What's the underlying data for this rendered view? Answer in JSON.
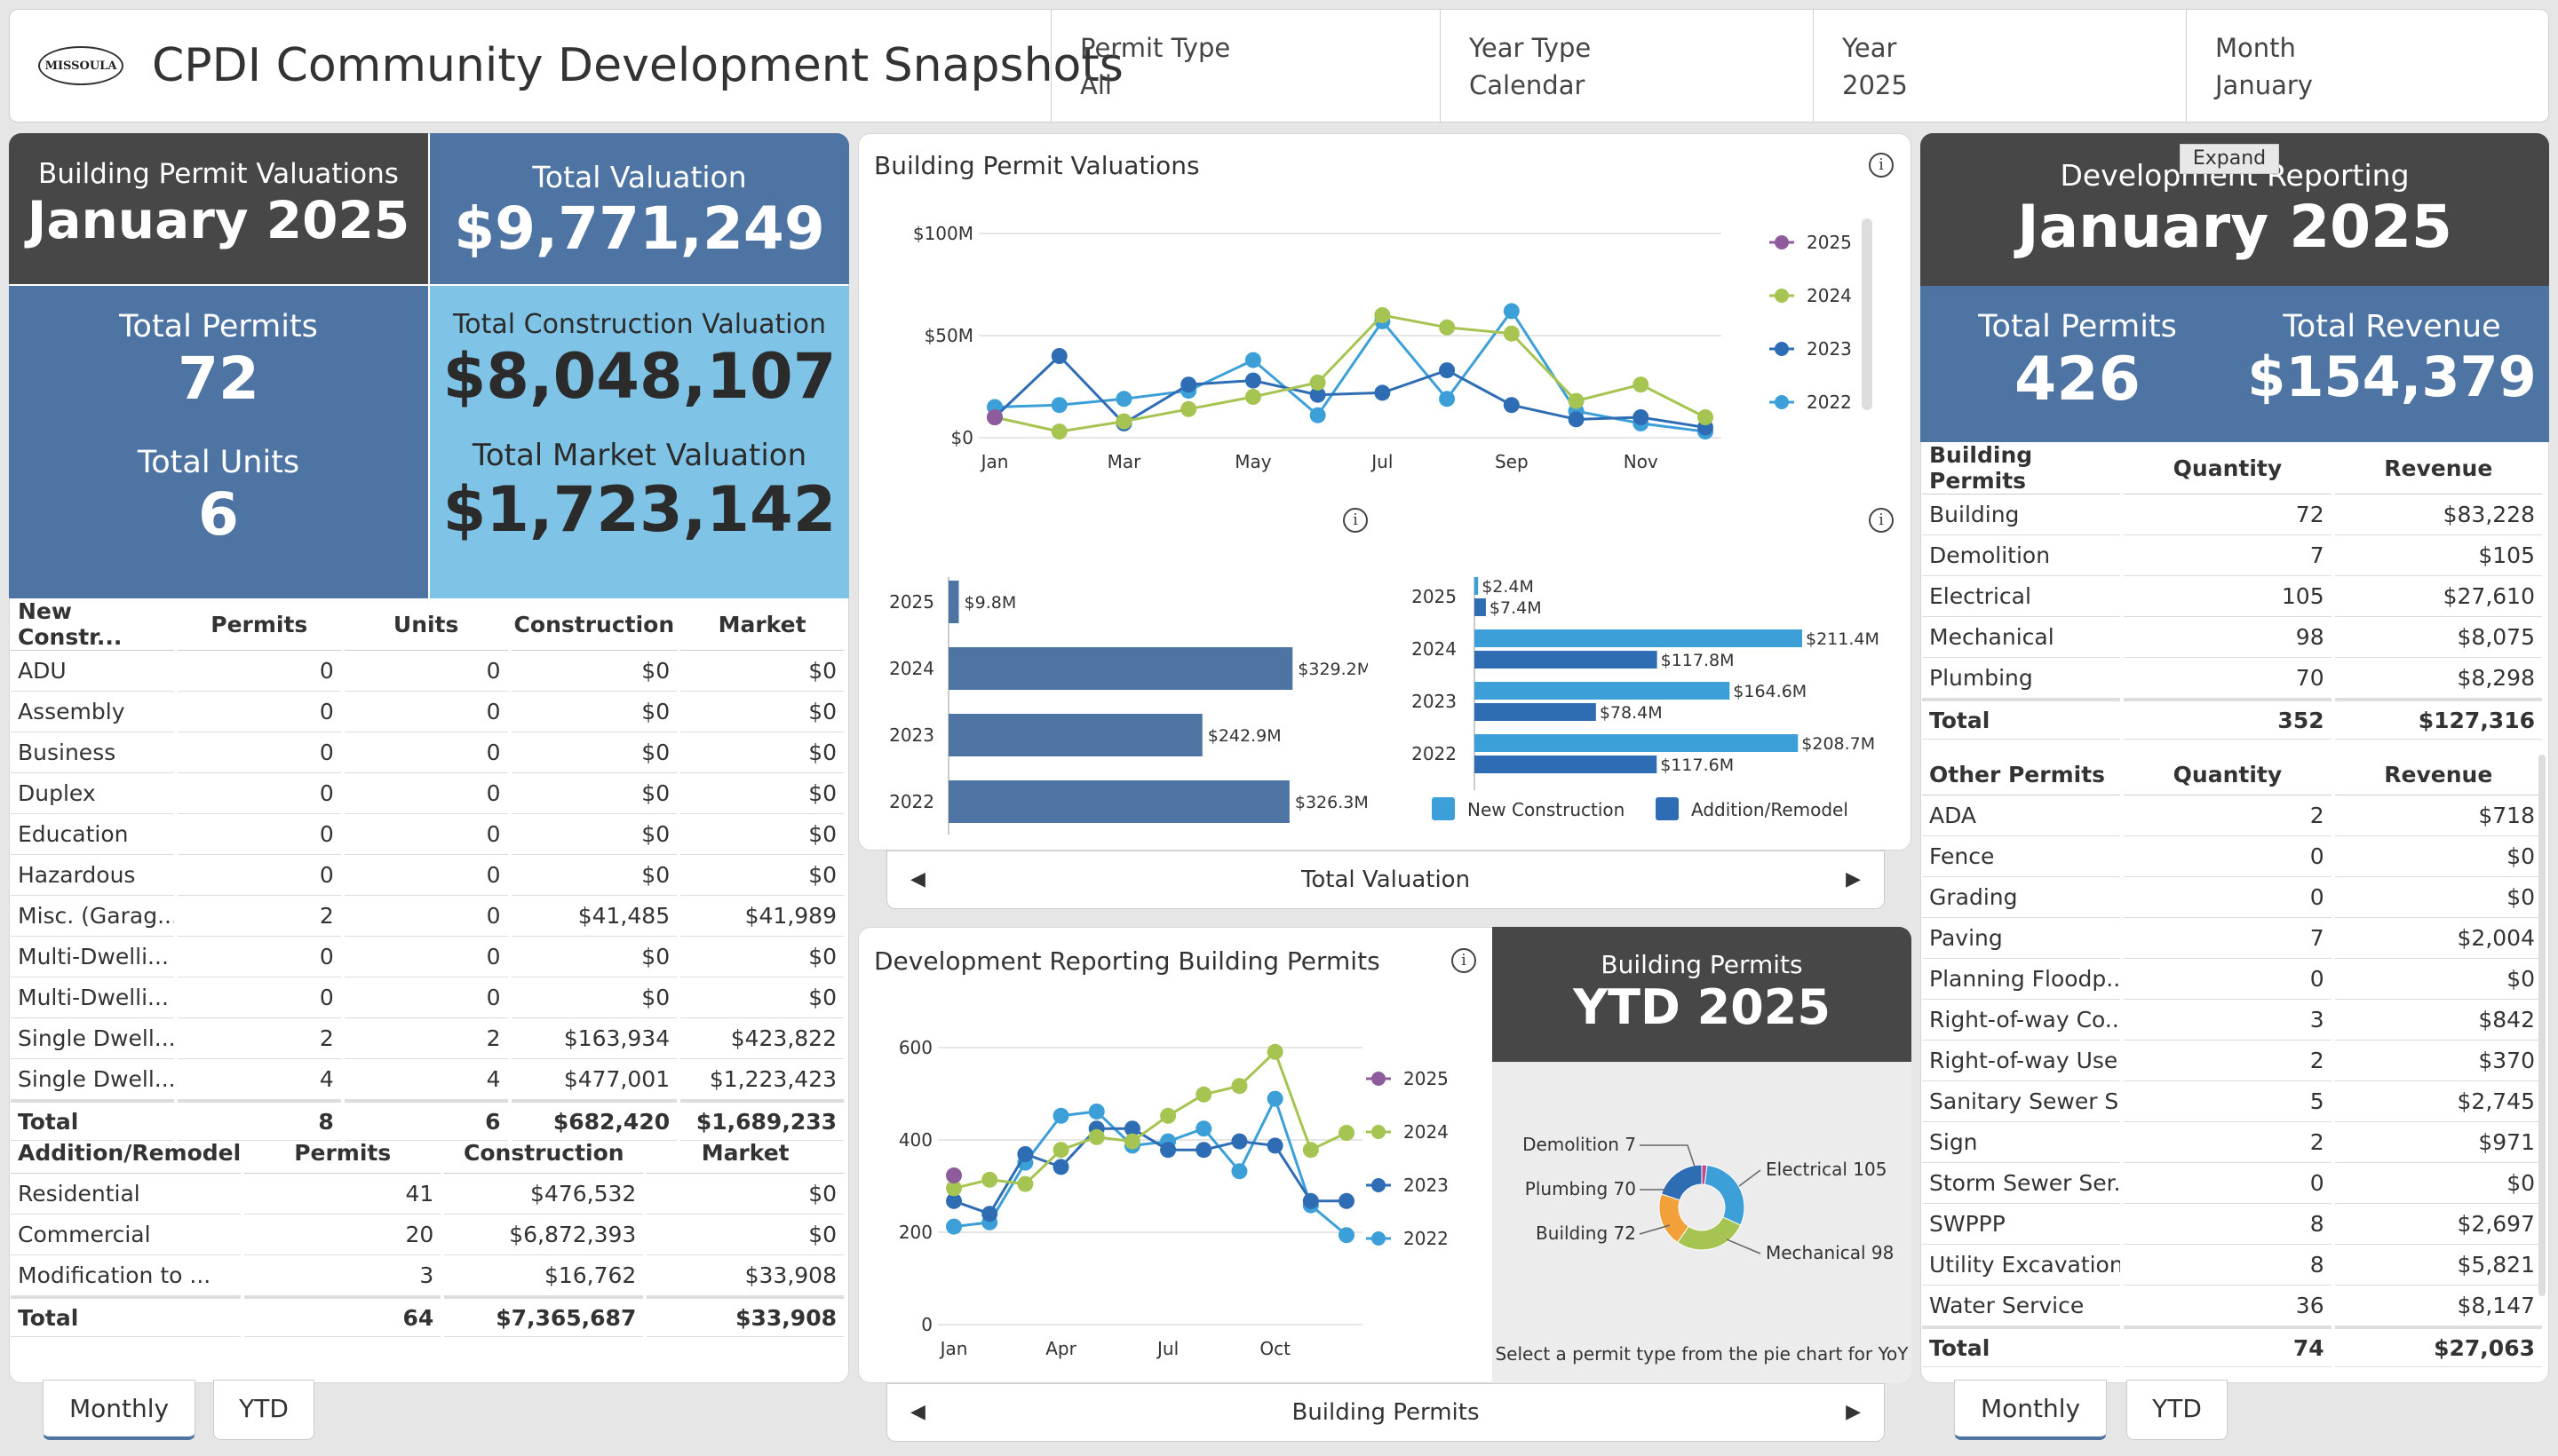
{
  "header": {
    "logo_text": "MISSOULA",
    "title": "CPDI Community Development Snapshots",
    "filters": [
      {
        "label": "Permit Type",
        "value": "All"
      },
      {
        "label": "Year Type",
        "value": "Calendar"
      },
      {
        "label": "Year",
        "value": "2025"
      },
      {
        "label": "Month",
        "value": "January"
      }
    ],
    "expand_label": "Expand"
  },
  "left": {
    "valuations_title": "Building Permit Valuations",
    "period": "January 2025",
    "total_valuation_label": "Total Valuation",
    "total_valuation": "$9,771,249",
    "total_permits_label": "Total Permits",
    "total_permits": "72",
    "total_units_label": "Total Units",
    "total_units": "6",
    "construction_label": "Total Construction Valuation",
    "construction": "$8,048,107",
    "market_label": "Total Market Valuation",
    "market": "$1,723,142",
    "new_construction": {
      "headers": [
        "New Constr...",
        "Permits",
        "Units",
        "Construction",
        "Market"
      ],
      "rows": [
        [
          "ADU",
          "0",
          "0",
          "$0",
          "$0"
        ],
        [
          "Assembly",
          "0",
          "0",
          "$0",
          "$0"
        ],
        [
          "Business",
          "0",
          "0",
          "$0",
          "$0"
        ],
        [
          "Duplex",
          "0",
          "0",
          "$0",
          "$0"
        ],
        [
          "Education",
          "0",
          "0",
          "$0",
          "$0"
        ],
        [
          "Hazardous",
          "0",
          "0",
          "$0",
          "$0"
        ],
        [
          "Misc. (Garag...",
          "2",
          "0",
          "$41,485",
          "$41,989"
        ],
        [
          "Multi-Dwelli...",
          "0",
          "0",
          "$0",
          "$0"
        ],
        [
          "Multi-Dwelli...",
          "0",
          "0",
          "$0",
          "$0"
        ],
        [
          "Single Dwell...",
          "2",
          "2",
          "$163,934",
          "$423,822"
        ],
        [
          "Single Dwell...",
          "4",
          "4",
          "$477,001",
          "$1,223,423"
        ]
      ],
      "total": [
        "Total",
        "8",
        "6",
        "$682,420",
        "$1,689,233"
      ]
    },
    "addition": {
      "headers": [
        "Addition/Remodel",
        "Permits",
        "Construction",
        "Market"
      ],
      "rows": [
        [
          "Residential",
          "41",
          "$476,532",
          "$0"
        ],
        [
          "Commercial",
          "20",
          "$6,872,393",
          "$0"
        ],
        [
          "Modification to ...",
          "3",
          "$16,762",
          "$33,908"
        ]
      ],
      "total": [
        "Total",
        "64",
        "$7,365,687",
        "$33,908"
      ]
    },
    "tabs": [
      "Monthly",
      "YTD"
    ]
  },
  "middle": {
    "line_chart_title": "Building Permit Valuations",
    "bar_nav_label": "Total Valuation",
    "dev_chart_title": "Development Reporting Building Permits",
    "dev_nav_label": "Building Permits",
    "ytd_title": "Building Permits",
    "ytd_period": "YTD 2025",
    "pie_hint": "Select a permit type from the pie chart for YoY"
  },
  "right": {
    "title": "Development Reporting",
    "period": "January 2025",
    "total_permits_label": "Total Permits",
    "total_permits": "426",
    "total_revenue_label": "Total Revenue",
    "total_revenue": "$154,379",
    "building": {
      "headers": [
        "Building Permits",
        "Quantity",
        "Revenue"
      ],
      "rows": [
        [
          "Building",
          "72",
          "$83,228"
        ],
        [
          "Demolition",
          "7",
          "$105"
        ],
        [
          "Electrical",
          "105",
          "$27,610"
        ],
        [
          "Mechanical",
          "98",
          "$8,075"
        ],
        [
          "Plumbing",
          "70",
          "$8,298"
        ]
      ],
      "total": [
        "Total",
        "352",
        "$127,316"
      ]
    },
    "other": {
      "headers": [
        "Other Permits",
        "Quantity",
        "Revenue"
      ],
      "rows": [
        [
          "ADA",
          "2",
          "$718"
        ],
        [
          "Fence",
          "0",
          "$0"
        ],
        [
          "Grading",
          "0",
          "$0"
        ],
        [
          "Paving",
          "7",
          "$2,004"
        ],
        [
          "Planning Floodp...",
          "0",
          "$0"
        ],
        [
          "Right-of-way Co...",
          "3",
          "$842"
        ],
        [
          "Right-of-way Use",
          "2",
          "$370"
        ],
        [
          "Sanitary Sewer S...",
          "5",
          "$2,745"
        ],
        [
          "Sign",
          "2",
          "$971"
        ],
        [
          "Storm Sewer Ser...",
          "0",
          "$0"
        ],
        [
          "SWPPP",
          "8",
          "$2,697"
        ],
        [
          "Utility Excavation",
          "8",
          "$5,821"
        ],
        [
          "Water Service",
          "36",
          "$8,147"
        ]
      ],
      "total": [
        "Total",
        "74",
        "$27,063"
      ]
    },
    "tabs": [
      "Monthly",
      "YTD"
    ]
  },
  "colors": {
    "dark": "#474747",
    "blue": "#4d74a3",
    "light_blue": "#7fc3e6",
    "s2025": "#8e5c9c",
    "s2024": "#a6c451",
    "s2023": "#2e6db4",
    "s2022": "#3d9fd8",
    "new_construction": "#3d9fd8",
    "addition": "#2e6db4"
  },
  "chart_data": [
    {
      "id": "valuation_line",
      "type": "line",
      "y_unit": "$M",
      "ylim": [
        0,
        100
      ],
      "yticks": [
        "$0",
        "$50M",
        "$100M"
      ],
      "x": [
        "Jan",
        "Feb",
        "Mar",
        "Apr",
        "May",
        "Jun",
        "Jul",
        "Aug",
        "Sep",
        "Oct",
        "Nov",
        "Dec"
      ],
      "xticks": [
        "Jan",
        "Mar",
        "May",
        "Jul",
        "Sep",
        "Nov"
      ],
      "series": [
        {
          "name": "2025",
          "values": [
            10
          ]
        },
        {
          "name": "2024",
          "values": [
            10,
            3,
            8,
            14,
            20,
            27,
            60,
            54,
            51,
            18,
            26,
            10
          ]
        },
        {
          "name": "2023",
          "values": [
            10,
            40,
            7,
            26,
            28,
            21,
            22,
            33,
            16,
            9,
            10,
            5
          ]
        },
        {
          "name": "2022",
          "values": [
            15,
            16,
            19,
            23,
            38,
            11,
            57,
            19,
            62,
            13,
            7,
            3
          ]
        }
      ],
      "legend": "right"
    },
    {
      "id": "total_valuation_bar",
      "type": "bar",
      "categories": [
        "2025",
        "2024",
        "2023",
        "2022"
      ],
      "values": [
        9.8,
        329.2
      ],
      "labels": [
        "$9.8M",
        "$329.2M",
        "$242.9M",
        "$326.3M"
      ],
      "values_all": [
        9.8,
        329.2,
        242.9,
        326.3
      ]
    },
    {
      "id": "valuation_split_bar",
      "type": "bar",
      "categories": [
        "2025",
        "2024",
        "2023",
        "2022"
      ],
      "series": [
        {
          "name": "New Construction",
          "values": [
            2.4,
            211.4,
            164.6,
            208.7
          ],
          "labels": [
            "$2.4M",
            "$211.4M",
            "$164.6M",
            "$208.7M"
          ]
        },
        {
          "name": "Addition/Remodel",
          "values": [
            7.4,
            117.8,
            78.4,
            117.6
          ],
          "labels": [
            "$7.4M",
            "$117.8M",
            "$78.4M",
            "$117.6M"
          ]
        }
      ],
      "legend": "bottom"
    },
    {
      "id": "dev_line",
      "type": "line",
      "ylim": [
        0,
        650
      ],
      "yticks": [
        "0",
        "200",
        "400",
        "600"
      ],
      "x": [
        "Jan",
        "Feb",
        "Mar",
        "Apr",
        "May",
        "Jun",
        "Jul",
        "Aug",
        "Sep",
        "Oct",
        "Nov",
        "Dec"
      ],
      "xticks": [
        "Jan",
        "Apr",
        "Jul",
        "Oct"
      ],
      "series": [
        {
          "name": "2025",
          "values": [
            350
          ]
        },
        {
          "name": "2024",
          "values": [
            320,
            340,
            330,
            410,
            440,
            430,
            490,
            540,
            560,
            640,
            410,
            450
          ]
        },
        {
          "name": "2023",
          "values": [
            290,
            260,
            400,
            370,
            460,
            460,
            410,
            410,
            430,
            420,
            290,
            290
          ]
        },
        {
          "name": "2022",
          "values": [
            230,
            240,
            380,
            490,
            500,
            420,
            430,
            460,
            360,
            530,
            280,
            210
          ]
        }
      ],
      "legend": "right"
    },
    {
      "id": "building_pie",
      "type": "pie",
      "labels": [
        "Demolition 7",
        "Plumbing 70",
        "Building 72",
        "Electrical 105",
        "Mechanical 98"
      ],
      "slices": [
        {
          "name": "Demolition",
          "value": 7,
          "color": "#c04a8a"
        },
        {
          "name": "Electrical",
          "value": 105,
          "color": "#3d9fd8"
        },
        {
          "name": "Mechanical",
          "value": 98,
          "color": "#a6c451"
        },
        {
          "name": "Building",
          "value": 72,
          "color": "#f2a13a"
        },
        {
          "name": "Plumbing",
          "value": 70,
          "color": "#2e6db4"
        }
      ]
    }
  ]
}
